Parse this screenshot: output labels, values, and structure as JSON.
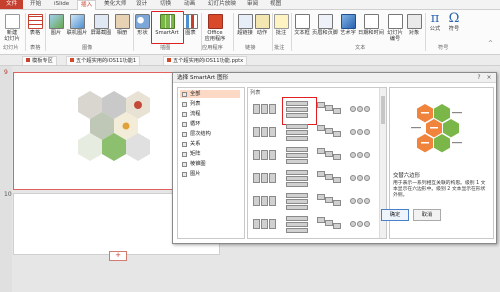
{
  "ribbon_tabs": [
    "文件",
    "开始",
    "iSlide",
    "插入",
    "美化大师",
    "设计",
    "切换",
    "动画",
    "幻灯片放映",
    "审阅",
    "视图"
  ],
  "ribbon": {
    "buttons": [
      {
        "label": "新建\n幻灯片",
        "group": "幻灯片"
      },
      {
        "label": "表格",
        "group": "表格"
      },
      {
        "label": "图片",
        "group": "图像"
      },
      {
        "label": "联机图片",
        "group": "图像"
      },
      {
        "label": "屏幕截图",
        "group": "图像"
      },
      {
        "label": "相册",
        "group": "图像"
      },
      {
        "label": "形状",
        "group": "插图"
      },
      {
        "label": "SmartArt",
        "group": "插图"
      },
      {
        "label": "图表",
        "group": "插图"
      },
      {
        "label": "Office\n应用程序",
        "group": "应用程序"
      },
      {
        "label": "超链接",
        "group": "链接"
      },
      {
        "label": "动作",
        "group": "链接"
      },
      {
        "label": "批注",
        "group": "批注"
      },
      {
        "label": "文本框",
        "group": "文本"
      },
      {
        "label": "页眉和页脚",
        "group": "文本"
      },
      {
        "label": "艺术字",
        "group": "文本"
      },
      {
        "label": "日期和时间",
        "group": "文本"
      },
      {
        "label": "幻灯片\n编号",
        "group": "文本"
      },
      {
        "label": "对象",
        "group": "文本"
      },
      {
        "label": "公式",
        "group": "符号"
      },
      {
        "label": "符号",
        "group": "符号"
      }
    ],
    "groups": [
      "幻灯片",
      "表格",
      "图像",
      "插图",
      "应用程序",
      "链接",
      "批注",
      "文本",
      "符号"
    ]
  },
  "doc_tabs": [
    "模板专区",
    "五个超实用的iOS11功能1",
    "五个超实用的iOS11功能.pptx"
  ],
  "slide_numbers": [
    "9",
    "10"
  ],
  "add_slide_label": "+",
  "dialog": {
    "title": "选择 SmartArt 图形",
    "help_btn": "?",
    "close_btn": "×",
    "categories": [
      "全部",
      "列表",
      "流程",
      "循环",
      "层次结构",
      "关系",
      "矩阵",
      "棱锥图",
      "图片"
    ],
    "selected_category": "全部",
    "gallery_header": "列表",
    "preview_name": "交替六边形",
    "preview_desc": "用于表示一系列相互关联的构思。级别 1 文本显示在六边形中。级别 2 文本显示在形状外侧。",
    "ok": "确定",
    "cancel": "取消"
  },
  "colors": {
    "accent": "#c5402f",
    "highlight": "#e02020",
    "hex_orange": "#f0843c",
    "hex_green": "#7ab648",
    "selected_cat": "#fcd9c5"
  }
}
